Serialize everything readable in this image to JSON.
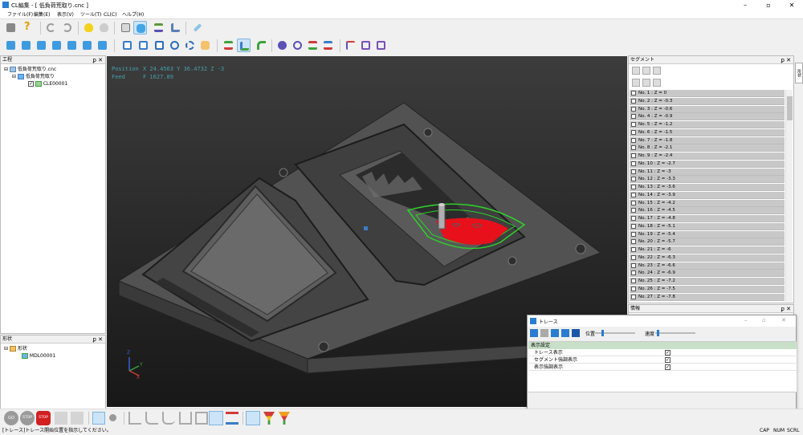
{
  "window": {
    "title": "CL編集 - [ 低負荷荒取り.cnc ]",
    "minimize": "–",
    "maximize": "▫",
    "close": "✕"
  },
  "menu": [
    "ファイル(F)",
    "編集(E)",
    "表示(V)",
    "ツール(T)",
    "CL(C)",
    "ヘルプ(H)"
  ],
  "process_panel": {
    "title": "工程",
    "pin": "ꝑ ✕",
    "tree": [
      {
        "label": "低負荷荒取り.cnc",
        "level": 0,
        "expander": "⊟"
      },
      {
        "label": "低負荷荒取り",
        "level": 1,
        "expander": "⊟"
      },
      {
        "label": "CLE00001",
        "level": 2,
        "expander": "",
        "checked": true
      }
    ]
  },
  "shape_panel": {
    "title": "形状",
    "pin": "ꝑ ✕",
    "tree": [
      {
        "label": "形状",
        "level": 0,
        "expander": "⊟"
      },
      {
        "label": "MDL00001",
        "level": 1,
        "expander": ""
      }
    ]
  },
  "viewport": {
    "position_label": "Position",
    "position_value": "X 24.4563  Y 36.4732  Z -3",
    "feed_label": "Feed",
    "feed_value": "F 1627.89",
    "axis_z": "Z",
    "axis_y": "Y",
    "axis_x": "X"
  },
  "segment_panel": {
    "title": "セグメント",
    "pin": "ꝑ ✕",
    "rows": [
      "No. 1 : Z = 0",
      "No. 2 : Z = -0.3",
      "No. 3 : Z = -0.6",
      "No. 4 : Z = -0.9",
      "No. 5 : Z = -1.2",
      "No. 6 : Z = -1.5",
      "No. 7 : Z = -1.8",
      "No. 8 : Z = -2.1",
      "No. 9 : Z = -2.4",
      "No. 10 : Z = -2.7",
      "No. 11 : Z = -3",
      "No. 12 : Z = -3.3",
      "No. 13 : Z = -3.6",
      "No. 14 : Z = -3.9",
      "No. 15 : Z = -4.2",
      "No. 16 : Z = -4.5",
      "No. 17 : Z = -4.8",
      "No. 18 : Z = -5.1",
      "No. 19 : Z = -5.4",
      "No. 20 : Z = -5.7",
      "No. 21 : Z = -6",
      "No. 22 : Z = -6.3",
      "No. 23 : Z = -6.6",
      "No. 24 : Z = -6.9",
      "No. 25 : Z = -7.2",
      "No. 26 : Z = -7.5",
      "No. 27 : Z = -7.8"
    ]
  },
  "info_panel": {
    "title": "情報",
    "pin": "ꝑ ✕"
  },
  "side_tab": {
    "label": "形状"
  },
  "trace_dialog": {
    "title": "トレース",
    "min": "–",
    "max": "▫",
    "close": "✕",
    "position_label": "位置",
    "speed_label": "速度",
    "position_frac": 0.15,
    "speed_frac": 0.03,
    "section_title": "表示設定",
    "settings": [
      {
        "label": "トレース表示",
        "checked": true
      },
      {
        "label": "セグメント強調表示",
        "checked": true
      },
      {
        "label": "表示強調表示",
        "checked": true
      }
    ]
  },
  "bottom_toolbar": {
    "go": "GO",
    "stop1": "STOP",
    "stop2": "STOP"
  },
  "statusbar": {
    "message": "[トレース]トレース開始位置を指示してください。",
    "cap": "CAP",
    "num": "NUM",
    "scrl": "SCRL"
  },
  "colors": {
    "accent": "#2a7cd1",
    "toolpath_red": "#e8101a",
    "toolpath_green": "#2ed12a",
    "stop_red": "#d21f1f"
  }
}
